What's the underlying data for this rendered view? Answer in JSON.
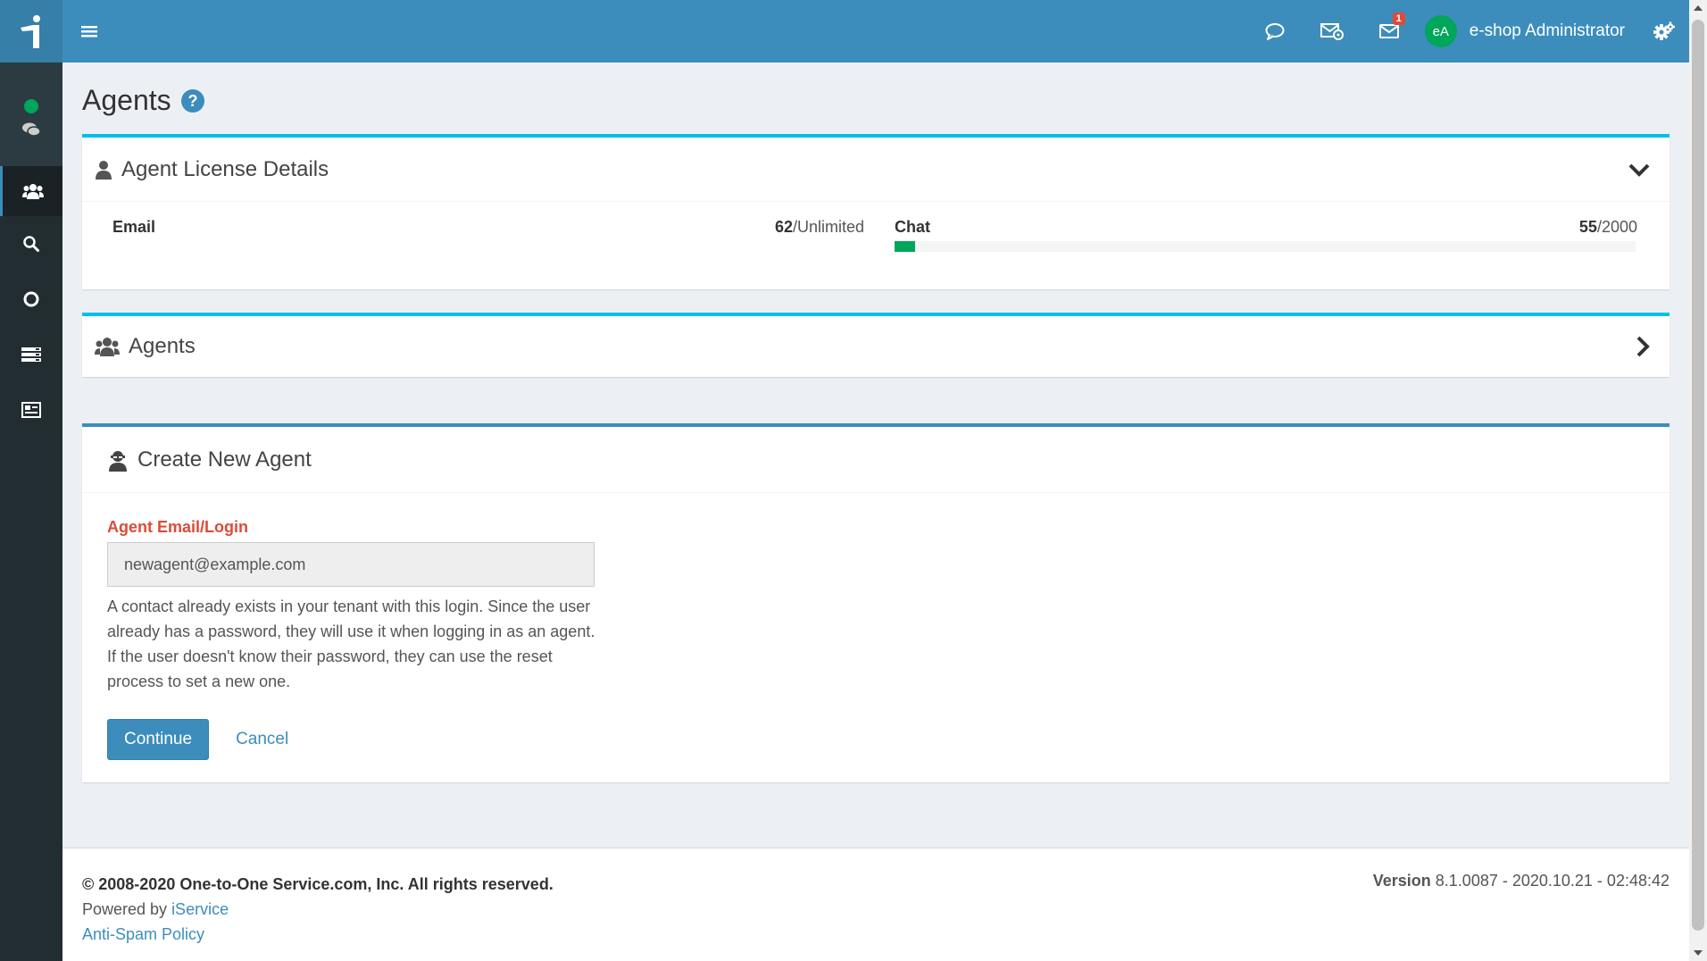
{
  "header": {
    "notification_count": "1",
    "user_initials": "eA",
    "user_name": "e-shop Administrator"
  },
  "sidebar": {
    "items": [
      "chat-icon",
      "users-icon",
      "search-icon",
      "circle-icon",
      "list-icon",
      "contact-card-icon"
    ]
  },
  "page": {
    "title": "Agents"
  },
  "license": {
    "title": "Agent License Details",
    "email_label": "Email",
    "email_used": "62",
    "email_limit": "/Unlimited",
    "chat_label": "Chat",
    "chat_used": "55",
    "chat_limit": "/2000",
    "chat_progress": 0.0275
  },
  "agents_box": {
    "title": "Agents"
  },
  "create_agent": {
    "title": "Create New Agent",
    "field_label": "Agent Email/Login",
    "field_value": "newagent@example.com",
    "help_text": "A contact already exists in your tenant with this login. Since the user already has a password, they will use it when logging in as an agent. If the user doesn't know their password, they can use the reset process to set a new one.",
    "continue_label": "Continue",
    "cancel_label": "Cancel"
  },
  "footer": {
    "copyright": "© 2008-2020 One-to-One Service.com, Inc. All rights reserved.",
    "powered_by_prefix": "Powered by ",
    "powered_by_link": "iService",
    "antispam_link": "Anti-Spam Policy",
    "version_label": "Version",
    "version_value": " 8.1.0087 - 2020.10.21 - 02:48:42"
  },
  "colors": {
    "header": "#3c8dbc",
    "sidebar": "#222d32",
    "accent_cyan": "#00c0ef",
    "success": "#00a65a",
    "danger": "#dd4b39"
  }
}
